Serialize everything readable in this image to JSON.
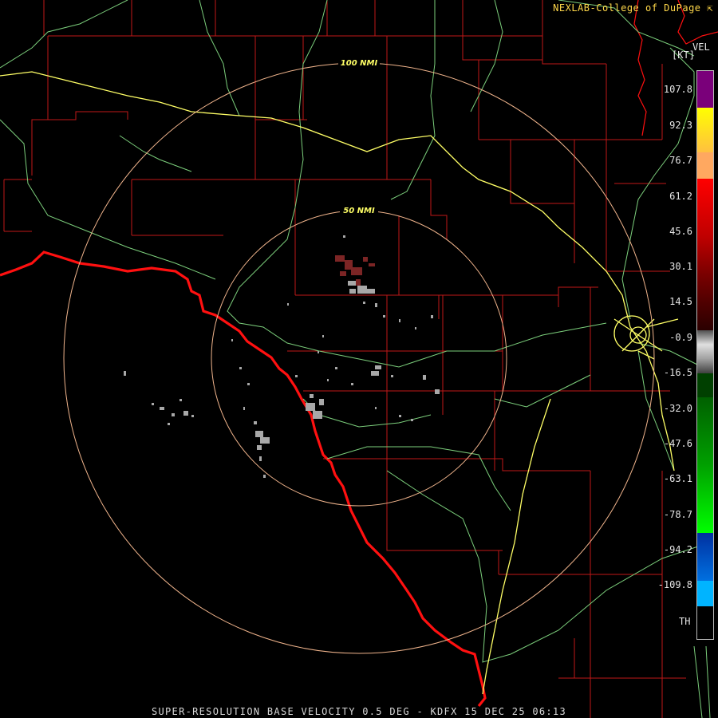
{
  "header": {
    "credit": "NEXLAB-College of DuPage",
    "credit_icon": "external-arrow-icon",
    "product": "VEL",
    "units": "[KT]"
  },
  "footer": {
    "caption": "SUPER-RESOLUTION BASE VELOCITY 0.5 DEG - KDFX 15 DEC 25 06:13"
  },
  "range_rings": [
    {
      "label": "100 NMI"
    },
    {
      "label": "50 NMI"
    }
  ],
  "legend": {
    "ticks": [
      "107.8",
      "92.3",
      "76.7",
      "61.2",
      "45.6",
      "30.1",
      "14.5",
      "-0.9",
      "-16.5",
      "-32.0",
      "-47.6",
      "-63.1",
      "-78.7",
      "-94.2",
      "-109.8"
    ],
    "th_label": "TH",
    "colors": {
      "purple": "#7a007a",
      "yellow": "#ffff00",
      "orange": "#ffa860",
      "red": "#ff0000",
      "dark_red": "#500000",
      "gray": "#a0a0a0",
      "dark_green": "#005a00",
      "green": "#00ff00",
      "blue": "#0050c0",
      "light_blue": "#00b4ff"
    }
  },
  "map_colors": {
    "county": "#c01818",
    "border": "#ff1010",
    "highway": "#7ccf7c",
    "interstate": "#ffff66",
    "ring": "#f0b48c",
    "echo": "#b0b0b0",
    "echo_red": "#8a2a2a"
  }
}
